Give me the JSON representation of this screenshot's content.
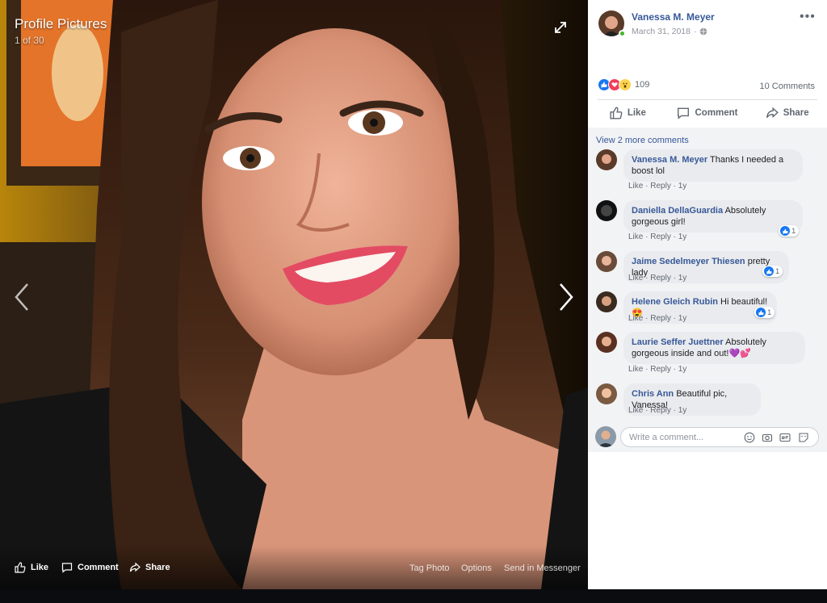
{
  "viewer": {
    "title": "Profile Pictures",
    "count": "1 of 30",
    "actions": {
      "like": "Like",
      "comment": "Comment",
      "share": "Share"
    },
    "links": {
      "tag_photo": "Tag Photo",
      "options": "Options",
      "send_messenger": "Send in Messenger"
    },
    "icons": {
      "expand": "expand-icon",
      "prev": "chevron-left-icon",
      "next": "chevron-right-icon"
    }
  },
  "post": {
    "author": "Vanessa M. Meyer",
    "date": "March 31, 2018",
    "privacy_icon": "globe-icon",
    "reactions_count": "109",
    "comments_count": "10 Comments",
    "actions": {
      "like": "Like",
      "comment": "Comment",
      "share": "Share"
    }
  },
  "comments": {
    "view_more": "View 2 more comments",
    "items": [
      {
        "name": "Vanessa M. Meyer",
        "text": "Thanks I needed a boost lol",
        "like": "Like",
        "reply": "Reply",
        "age": "1y"
      },
      {
        "name": "Daniella DellaGuardia",
        "text": "Absolutely gorgeous girl!",
        "like": "Like",
        "reply": "Reply",
        "age": "1y",
        "reactions": "1"
      },
      {
        "name": "Jaime Sedelmeyer Thiesen",
        "text": "pretty lady",
        "like": "Like",
        "reply": "Reply",
        "age": "1y",
        "reactions": "1"
      },
      {
        "name": "Helene Gleich Rubin",
        "text": "Hi beautiful! 😍",
        "like": "Like",
        "reply": "Reply",
        "age": "1y",
        "reactions": "1"
      },
      {
        "name": "Laurie Seffer Juettner",
        "text": "Absolutely gorgeous inside and out!💜💕",
        "like": "Like",
        "reply": "Reply",
        "age": "1y"
      },
      {
        "name": "Chris Ann",
        "text": "Beautiful pic, Vanessa!",
        "like": "Like",
        "reply": "Reply",
        "age": "1y"
      }
    ]
  },
  "composer": {
    "placeholder": "Write a comment..."
  },
  "colors": {
    "link": "#365899",
    "facebook_blue": "#1877f2",
    "love_red": "#f33e58",
    "panel_bg": "#f2f3f5"
  }
}
